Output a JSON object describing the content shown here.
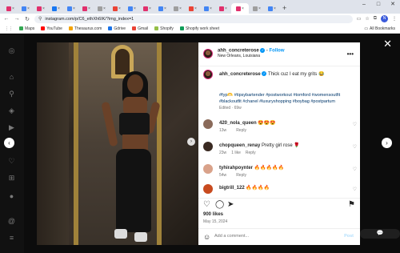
{
  "browser": {
    "tabs": [
      {
        "color": "#e1306c"
      },
      {
        "color": "#4285f4"
      },
      {
        "color": "#e1306c"
      },
      {
        "color": "#1877f2"
      },
      {
        "color": "#4285f4"
      },
      {
        "color": "#e1306c"
      },
      {
        "color": "#9e9e9e"
      },
      {
        "color": "#ea4335"
      },
      {
        "color": "#4285f4"
      },
      {
        "color": "#e1306c"
      },
      {
        "color": "#4285f4"
      },
      {
        "color": "#9e9e9e"
      },
      {
        "color": "#ea4335"
      },
      {
        "color": "#4285f4"
      },
      {
        "color": "#e1306c"
      },
      {
        "color": "#e1306c"
      },
      {
        "color": "#9e9e9e"
      },
      {
        "color": "#4285f4"
      }
    ],
    "url": "instagram.com/p/C6_ethXh6IK/?img_index=1",
    "profile_initial": "N",
    "bookmarks": [
      {
        "label": "Maps",
        "color": "#34a853"
      },
      {
        "label": "YouTube",
        "color": "#ff0000"
      },
      {
        "label": "Thesaurus.com",
        "color": "#f4a300"
      },
      {
        "label": "Gdrive",
        "color": "#1a73e8"
      },
      {
        "label": "Gmail",
        "color": "#ea4335"
      },
      {
        "label": "Shopify",
        "color": "#95bf47"
      },
      {
        "label": "Shopify work sheet",
        "color": "#0f9d58"
      }
    ],
    "all_bookmarks": "All Bookmarks"
  },
  "post": {
    "username": "ahh_concreterose",
    "follow_label": "Follow",
    "location": "New Orleans, Louisiana",
    "caption": "Thick cuz I eat my grits 😂",
    "hashtags": "#fyp🫶 #tipsybartender #postworkout #tomford #womensoutfit #blackoutfit #chanel #luxuryshopping #boybag #postpartum",
    "caption_meta": "Edited · 69w",
    "likes": "900 likes",
    "date": "May 15, 2024",
    "comment_placeholder": "Add a comment...",
    "post_label": "Post"
  },
  "comments": [
    {
      "user": "420_nola_queen",
      "text": "😍😍😍",
      "time": "13w",
      "likes": "",
      "reply": "Reply",
      "avatar_color": "#8a6a5a"
    },
    {
      "user": "chopqueen_renay",
      "text": "Pretty girl rose 🌹",
      "time": "23w",
      "likes": "1 like",
      "reply": "Reply",
      "avatar_color": "#3a2a22"
    },
    {
      "user": "tyhirahpoynter",
      "text": "🔥🔥🔥🔥🔥",
      "time": "54w",
      "likes": "",
      "reply": "Reply",
      "avatar_color": "#d9a28a"
    },
    {
      "user": "bigtrill_122",
      "text": "🔥🔥🔥🔥",
      "time": "",
      "likes": "",
      "reply": "",
      "avatar_color": "#c84a1e"
    }
  ],
  "toast": "💬"
}
